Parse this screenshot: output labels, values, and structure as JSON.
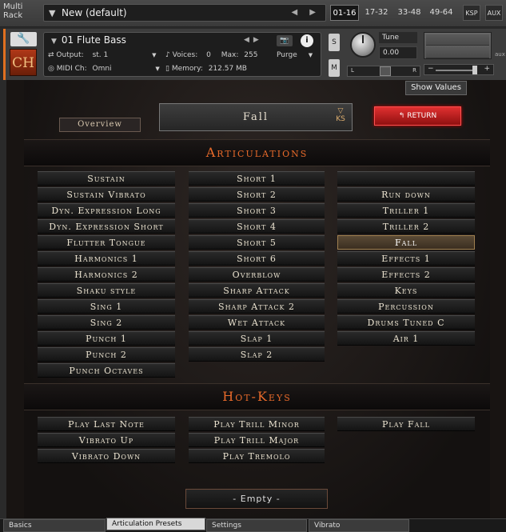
{
  "rack": {
    "label_line1": "Multi",
    "label_line2": "Rack",
    "preset_name": "New (default)",
    "preset_nav": "◀ ▶",
    "pages": [
      "01-16",
      "17-32",
      "33-48",
      "49-64"
    ],
    "ksp_label": "KSP",
    "aux_label": "AUX"
  },
  "instrument": {
    "logo": "CH",
    "name": "01 Flute Bass",
    "output_label": "Output:",
    "output_value": "st. 1",
    "voices_label": "Voices:",
    "voices_value": "0",
    "max_label": "Max:",
    "max_value": "255",
    "purge_label": "Purge",
    "midi_label": "MIDI Ch:",
    "midi_value": "Omni",
    "memory_label": "Memory:",
    "memory_value": "212.57 MB",
    "solo_label": "S",
    "mute_label": "M",
    "tune_label": "Tune",
    "tune_value": "0.00",
    "pan_left": "L",
    "pan_right": "R",
    "aux_side": "aux",
    "info_label": "i"
  },
  "panel": {
    "show_values": "Show Values",
    "overview": "Overview",
    "current_articulation": "Fall",
    "ks_label": "KS",
    "return_label": "RETURN",
    "articulations_header": "Articulations",
    "hotkeys_header": "Hot-Keys",
    "empty_label": "- Empty -",
    "selected_color": "#a08050",
    "accent_color": "#e86a2a"
  },
  "articulations": {
    "col1": [
      "Sustain",
      "Sustain Vibrato",
      "Dyn. Expression Long",
      "Dyn. Expression Short",
      "Flutter Tongue",
      "Harmonics 1",
      "Harmonics 2",
      "Shaku style",
      "Sing 1",
      "Sing 2",
      "Punch 1",
      "Punch 2",
      "Punch Octaves"
    ],
    "col2": [
      "Short 1",
      "Short 2",
      "Short 3",
      "Short 4",
      "Short 5",
      "Short 6",
      "Overblow",
      "Sharp Attack",
      "Sharp Attack 2",
      "Wet Attack",
      "Slap 1",
      "Slap 2"
    ],
    "col3": [
      "",
      "Run down",
      "Triller 1",
      "Triller 2",
      "Fall",
      "Effects 1",
      "Effects 2",
      "Keys",
      "Percussion",
      "Drums Tuned C",
      "Air 1"
    ],
    "selected": "Fall"
  },
  "hotkeys": {
    "col1": [
      "Play Last Note",
      "Vibrato Up",
      "Vibrato Down"
    ],
    "col2": [
      "Play Trill Minor",
      "Play Trill Major",
      "Play Tremolo"
    ],
    "col3": [
      "Play Fall"
    ]
  },
  "tabs": [
    "Basics",
    "Articulation Presets",
    "Settings",
    "Vibrato"
  ],
  "active_tab": "Articulation Presets"
}
